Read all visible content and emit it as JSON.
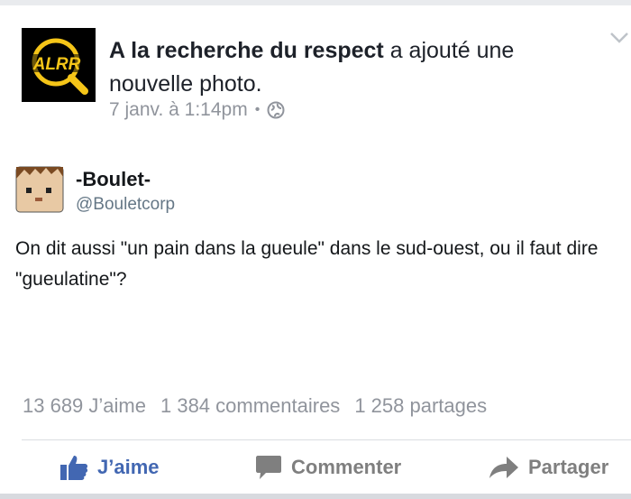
{
  "post": {
    "page_name": "A la recherche du respect",
    "action_text": " a ajouté une nouvelle photo.",
    "timestamp": "7 janv. à 1:14pm",
    "separator": "•",
    "logo_text": "ALRR",
    "privacy_icon": "globe-icon",
    "menu_icon": "chevron-down-icon"
  },
  "tweet": {
    "display_name": "-Boulet-",
    "handle": "@Bouletcorp",
    "text": "On dit aussi \"un pain dans la gueule\" dans le sud-ouest, ou il faut dire \"gueulatine\"?"
  },
  "stats": {
    "likes": "13 689 J’aime",
    "comments": "1 384 commentaires",
    "shares": "1 258 partages"
  },
  "actions": {
    "like_label": "J’aime",
    "comment_label": "Commenter",
    "share_label": "Partager"
  },
  "colors": {
    "accent": "#4267b2",
    "logo_yellow": "#f5c518",
    "text": "#1d2129",
    "muted": "#90949c"
  }
}
